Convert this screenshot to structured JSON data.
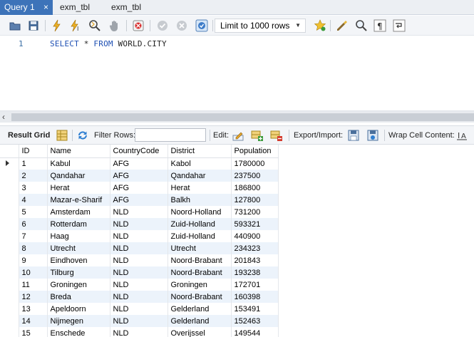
{
  "tabs": [
    {
      "label": "Query 1",
      "active": true,
      "close": "×"
    },
    {
      "label": "exm_tbl",
      "active": false
    },
    {
      "label": "exm_tbl",
      "active": false
    }
  ],
  "toolbar": {
    "icons": [
      "open-file-icon",
      "save-icon",
      "execute-icon",
      "execute-current-icon",
      "explain-icon",
      "stop-icon",
      "toggle-error-icon",
      "commit-icon",
      "rollback-icon",
      "autocommit-icon",
      "bookmark-icon",
      "beautify-icon",
      "find-icon",
      "invisible-chars-icon",
      "wrap-icon"
    ],
    "limit": "Limit to 1000 rows"
  },
  "editor": {
    "line_number": "1",
    "keyword_select": "SELECT",
    "star": "*",
    "keyword_from": "FROM",
    "table": "WORLD.CITY"
  },
  "result_toolbar": {
    "result_grid": "Result Grid",
    "filter_rows": "Filter Rows:",
    "filter_value": "",
    "edit": "Edit:",
    "export_import": "Export/Import:",
    "wrap_cell": "Wrap Cell Content:"
  },
  "grid": {
    "columns": [
      "ID",
      "Name",
      "CountryCode",
      "District",
      "Population"
    ],
    "rows": [
      [
        "1",
        "Kabul",
        "AFG",
        "Kabol",
        "1780000"
      ],
      [
        "2",
        "Qandahar",
        "AFG",
        "Qandahar",
        "237500"
      ],
      [
        "3",
        "Herat",
        "AFG",
        "Herat",
        "186800"
      ],
      [
        "4",
        "Mazar-e-Sharif",
        "AFG",
        "Balkh",
        "127800"
      ],
      [
        "5",
        "Amsterdam",
        "NLD",
        "Noord-Holland",
        "731200"
      ],
      [
        "6",
        "Rotterdam",
        "NLD",
        "Zuid-Holland",
        "593321"
      ],
      [
        "7",
        "Haag",
        "NLD",
        "Zuid-Holland",
        "440900"
      ],
      [
        "8",
        "Utrecht",
        "NLD",
        "Utrecht",
        "234323"
      ],
      [
        "9",
        "Eindhoven",
        "NLD",
        "Noord-Brabant",
        "201843"
      ],
      [
        "10",
        "Tilburg",
        "NLD",
        "Noord-Brabant",
        "193238"
      ],
      [
        "11",
        "Groningen",
        "NLD",
        "Groningen",
        "172701"
      ],
      [
        "12",
        "Breda",
        "NLD",
        "Noord-Brabant",
        "160398"
      ],
      [
        "13",
        "Apeldoorn",
        "NLD",
        "Gelderland",
        "153491"
      ],
      [
        "14",
        "Nijmegen",
        "NLD",
        "Gelderland",
        "152463"
      ],
      [
        "15",
        "Enschede",
        "NLD",
        "Overijssel",
        "149544"
      ]
    ]
  },
  "colors": {
    "tab_active": "#3d73b9",
    "keyword": "#1d4fb3",
    "row_alt": "#ecf3fb"
  }
}
